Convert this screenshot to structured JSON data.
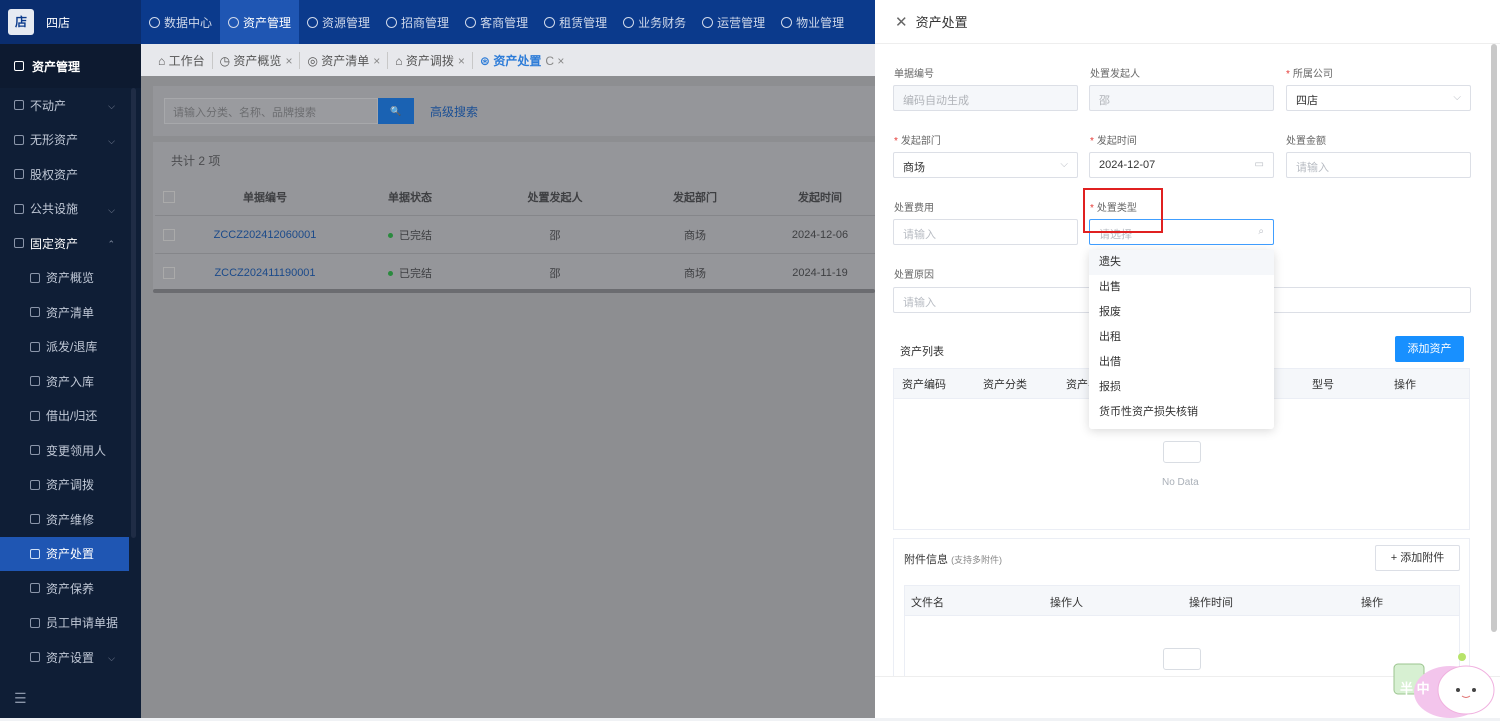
{
  "header": {
    "logo_text": "四店",
    "logo_box": "店",
    "nav": [
      "数据中心",
      "资产管理",
      "资源管理",
      "招商管理",
      "客商管理",
      "租赁管理",
      "业务财务",
      "运营管理",
      "物业管理"
    ]
  },
  "sidebar": {
    "title": "资产管理",
    "items": [
      {
        "label": "不动产",
        "arrow": "⌵"
      },
      {
        "label": "无形资产",
        "arrow": "⌵"
      },
      {
        "label": "股权资产",
        "arrow": ""
      },
      {
        "label": "公共设施",
        "arrow": "⌵"
      },
      {
        "label": "固定资产",
        "arrow": "⌃"
      }
    ],
    "sub_items": [
      "资产概览",
      "资产清单",
      "派发/退库",
      "资产入库",
      "借出/归还",
      "变更领用人",
      "资产调拨",
      "资产维修",
      "资产处置",
      "资产保养",
      "员工申请单据",
      "资产设置"
    ],
    "footer_icon": "☰"
  },
  "tabs": [
    {
      "label": "工作台",
      "close": ""
    },
    {
      "label": "资产概览",
      "close": "×"
    },
    {
      "label": "资产清单",
      "close": "×"
    },
    {
      "label": "资产调拨",
      "close": "×"
    },
    {
      "label": "资产处置",
      "close": "C ×"
    }
  ],
  "list": {
    "search_placeholder": "请输入分类、名称、品牌搜索",
    "search_btn": "🔍",
    "advanced": "高级搜索",
    "count": "共计 2 项",
    "columns": [
      "单据编号",
      "单据状态",
      "处置发起人",
      "发起部门",
      "发起时间"
    ],
    "rows": [
      [
        "ZCCZ202412060001",
        "已完结",
        "邵",
        "商场",
        "2024-12-06"
      ],
      [
        "ZCCZ202411190001",
        "已完结",
        "邵",
        "商场",
        "2024-11-19"
      ]
    ]
  },
  "drawer": {
    "title": "资产处置",
    "close": "✕",
    "fields": {
      "doc_no": {
        "label": "单据编号",
        "value": "编码自动生成"
      },
      "initiator": {
        "label": "处置发起人",
        "value": "邵"
      },
      "company": {
        "label": "所属公司",
        "value": "四店"
      },
      "dept": {
        "label": "发起部门",
        "value": "商场"
      },
      "time": {
        "label": "发起时间",
        "value": "2024-12-07"
      },
      "amount": {
        "label": "处置金额",
        "placeholder": "请输入"
      },
      "fee": {
        "label": "处置费用",
        "placeholder": "请输入"
      },
      "type": {
        "label": "处置类型",
        "placeholder": "请选择"
      },
      "reason": {
        "label": "处置原因",
        "placeholder": "请输入"
      }
    },
    "type_options": [
      "遗失",
      "出售",
      "报废",
      "出租",
      "出借",
      "报损",
      "货币性资产损失核销"
    ],
    "asset_list": {
      "title": "资产列表",
      "add_btn": "添加资产",
      "columns": [
        "资产编码",
        "资产分类",
        "资产名",
        "型号",
        "操作"
      ],
      "empty": "No Data"
    },
    "attachments": {
      "title": "附件信息",
      "hint": "(支持多附件)",
      "add_btn": "+ 添加附件",
      "columns": [
        "文件名",
        "操作人",
        "操作时间",
        "操作"
      ]
    }
  },
  "mascot_text": "半 中"
}
